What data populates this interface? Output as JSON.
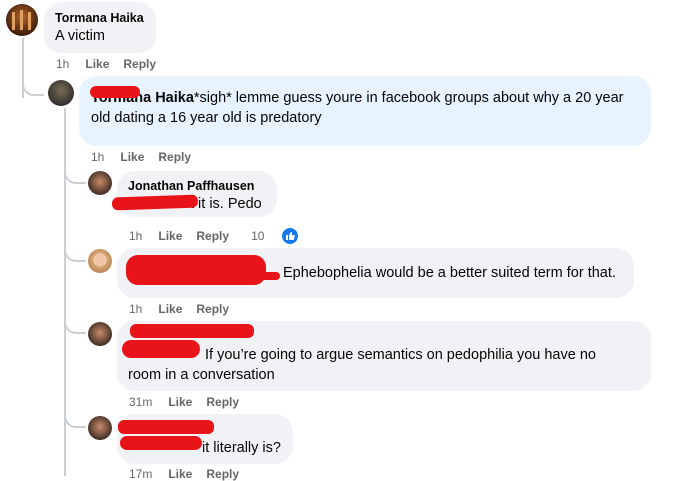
{
  "comments": [
    {
      "author": "Tormana Haika",
      "text": "A victim",
      "time": "1h",
      "like": "Like",
      "reply": "Reply"
    },
    {
      "mention": "Tormana Haika",
      "text": "*sigh* lemme guess youre in facebook groups about why a 20 year old dating a 16 year old is predatory",
      "time": "1h",
      "like": "Like",
      "reply": "Reply"
    },
    {
      "author": "Jonathan Paffhausen",
      "text": "t it is. Pedo",
      "time": "1h",
      "like": "Like",
      "reply": "Reply",
      "reactions": "10"
    },
    {
      "text": "Ephebophelia would be a better suited term for that.",
      "time": "1h",
      "like": "Like",
      "reply": "Reply"
    },
    {
      "text_line1": "If you’re going to argue semantics on pedophilia you have no",
      "text_line2": "room in a conversation",
      "time": "31m",
      "like": "Like",
      "reply": "Reply"
    },
    {
      "text": "it literally is?",
      "time": "17m",
      "like": "Like",
      "reply": "Reply"
    }
  ],
  "icons": {
    "reaction": "thumbs-up-icon"
  },
  "colors": {
    "accent": "#1877f2",
    "redaction": "#e8141a",
    "bubble": "#f0f2f5",
    "highlight": "#e7f3ff"
  }
}
